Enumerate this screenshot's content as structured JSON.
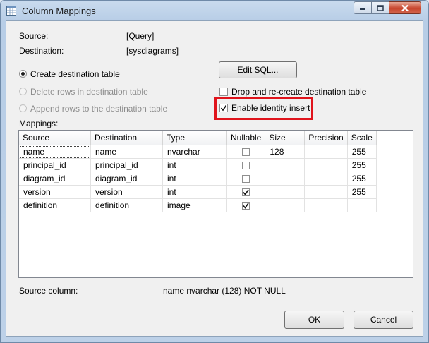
{
  "window": {
    "title": "Column Mappings"
  },
  "info": {
    "source_label": "Source:",
    "source_value": "[Query]",
    "destination_label": "Destination:",
    "destination_value": "[sysdiagrams]"
  },
  "options": {
    "create": "Create destination table",
    "delete": "Delete rows in destination table",
    "append": "Append rows to the destination table",
    "edit_sql": "Edit SQL...",
    "drop_recreate": "Drop and re-create destination table",
    "identity_insert": "Enable identity insert"
  },
  "mappings": {
    "label": "Mappings:",
    "columns": [
      "Source",
      "Destination",
      "Type",
      "Nullable",
      "Size",
      "Precision",
      "Scale"
    ],
    "rows": [
      {
        "source": "name",
        "destination": "name",
        "type": "nvarchar",
        "nullable": false,
        "size": "128",
        "precision": "",
        "scale": "255"
      },
      {
        "source": "principal_id",
        "destination": "principal_id",
        "type": "int",
        "nullable": false,
        "size": "",
        "precision": "",
        "scale": "255"
      },
      {
        "source": "diagram_id",
        "destination": "diagram_id",
        "type": "int",
        "nullable": false,
        "size": "",
        "precision": "",
        "scale": "255"
      },
      {
        "source": "version",
        "destination": "version",
        "type": "int",
        "nullable": true,
        "size": "",
        "precision": "",
        "scale": "255"
      },
      {
        "source": "definition",
        "destination": "definition",
        "type": "image",
        "nullable": true,
        "size": "",
        "precision": "",
        "scale": ""
      }
    ]
  },
  "footer": {
    "source_column_label": "Source column:",
    "source_column_value": "name nvarchar (128) NOT NULL",
    "ok": "OK",
    "cancel": "Cancel"
  },
  "state": {
    "create_selected": true,
    "drop_recreate_checked": false,
    "identity_insert_checked": true
  },
  "colors": {
    "highlight": "#e0141c",
    "client_bg": "#f0f0f0"
  }
}
